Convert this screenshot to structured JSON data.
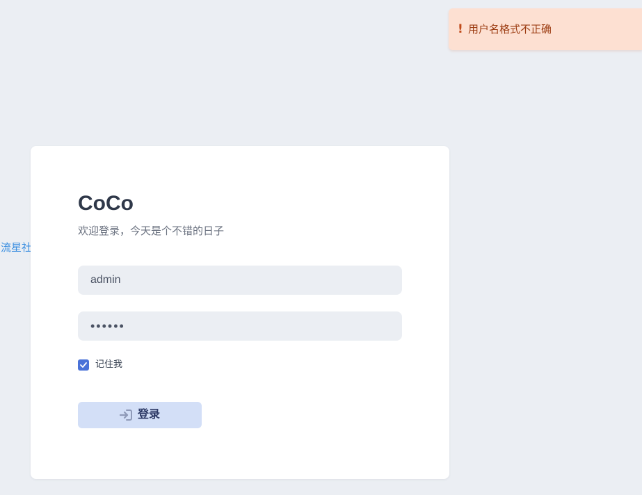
{
  "toast": {
    "icon": "!",
    "message": "用户名格式不正确",
    "icon_name": "exclamation-icon",
    "bg_color": "#fde0d2",
    "text_color": "#9c3c12"
  },
  "side_label": "流星社区",
  "login": {
    "title": "CoCo",
    "subtitle": "欢迎登录，今天是个不错的日子",
    "username_value": "admin",
    "password_value": "••••••",
    "remember_label": "记住我",
    "remember_checked": true,
    "submit_label": "登录",
    "submit_icon": "sign-in-icon"
  },
  "colors": {
    "background": "#ebeef3",
    "accent": "#4a72d8",
    "button_bg": "#d3dff7",
    "link": "#3a8ee0"
  }
}
